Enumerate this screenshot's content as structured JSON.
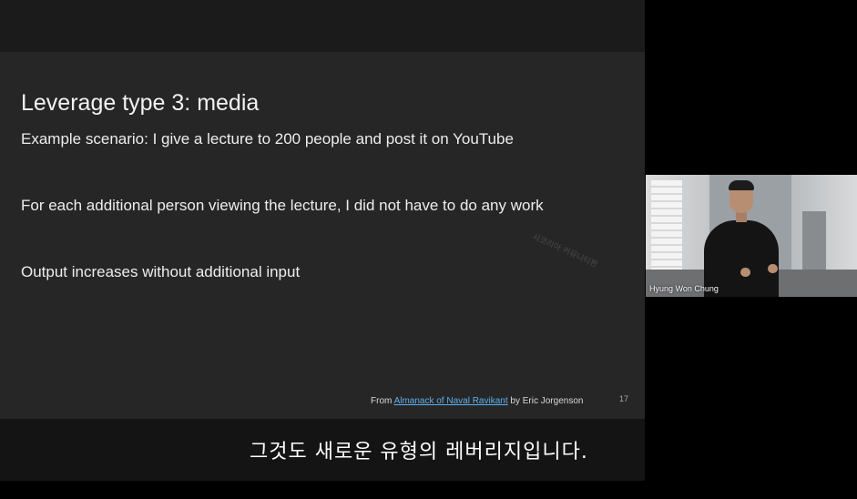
{
  "slide": {
    "title": "Leverage type 3: media",
    "lines": [
      "Example scenario: I give a lecture to 200 people and post it on YouTube",
      "For each additional person viewing the lecture, I did not have to do any work",
      "Output increases without additional input"
    ],
    "watermark": "시코리아 커뮤니티판",
    "citation": {
      "prefix": "From ",
      "link": "Almanack of Naval Ravikant",
      "suffix": " by Eric Jorgenson"
    },
    "page_number": "17"
  },
  "subtitle": "그것도 새로운 유형의 레버리지입니다.",
  "participant": {
    "name": "Hyung Won Chung"
  },
  "colors": {
    "slide_background": "#262626",
    "link": "#5db0ec",
    "page_background": "#000000"
  }
}
